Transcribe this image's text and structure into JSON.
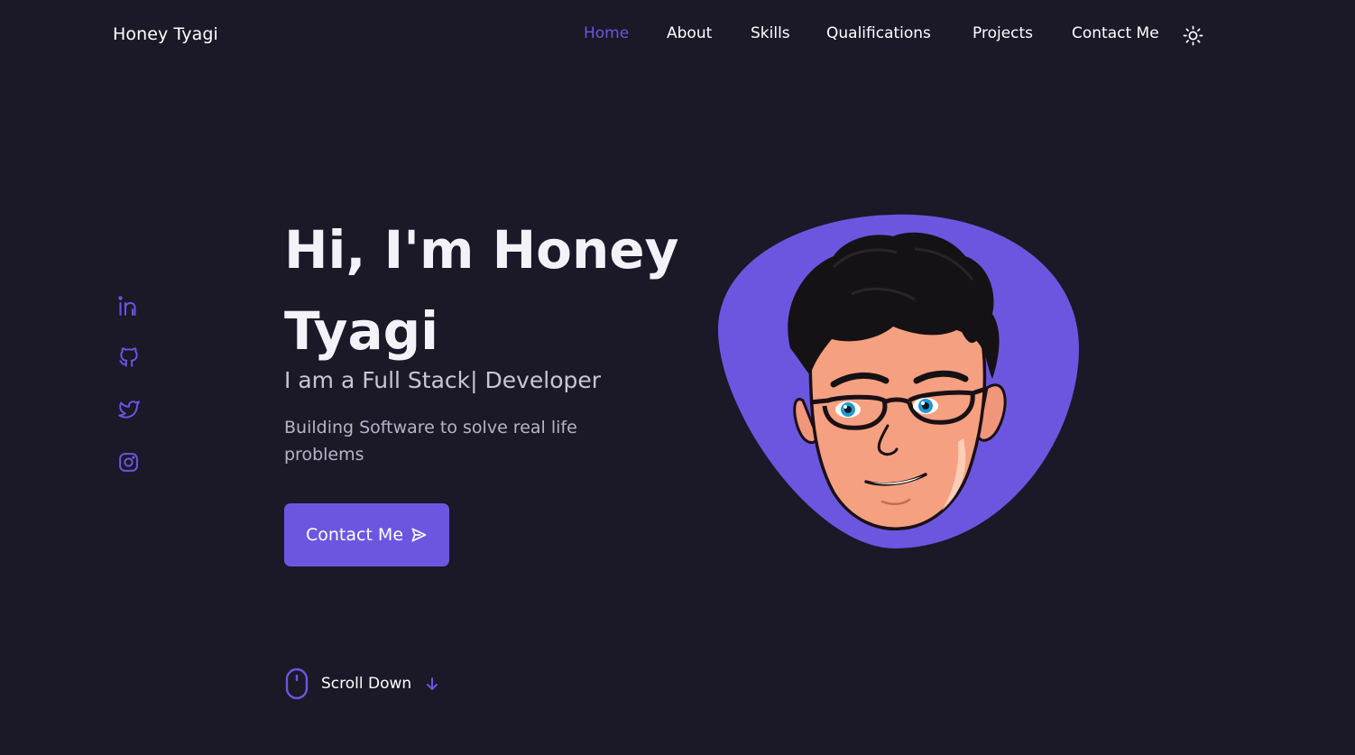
{
  "brand": {
    "name": "Honey Tyagi"
  },
  "nav": {
    "items": [
      {
        "label": "Home",
        "active": true
      },
      {
        "label": "About",
        "active": false
      },
      {
        "label": "Skills",
        "active": false
      },
      {
        "label": "Qualifications",
        "active": false
      },
      {
        "label": "Projects",
        "active": false
      },
      {
        "label": "Contact Me",
        "active": false
      }
    ],
    "theme_icon": "sun-icon"
  },
  "social": [
    {
      "icon": "linkedin-icon"
    },
    {
      "icon": "github-icon"
    },
    {
      "icon": "twitter-icon"
    },
    {
      "icon": "instagram-icon"
    }
  ],
  "hero": {
    "title": "Hi, I'm Honey Tyagi",
    "subtitle": "I am a Full Stack| Developer",
    "description": "Building Software to solve real life problems",
    "cta_label": "Contact Me",
    "cta_icon": "send-icon"
  },
  "scroll": {
    "label": "Scroll Down",
    "icon": "mouse-icon",
    "arrow_icon": "arrow-down-icon"
  },
  "colors": {
    "background": "#1b1828",
    "accent": "#6c56e0",
    "text": "#ffffff",
    "muted": "#b7b4c7"
  }
}
